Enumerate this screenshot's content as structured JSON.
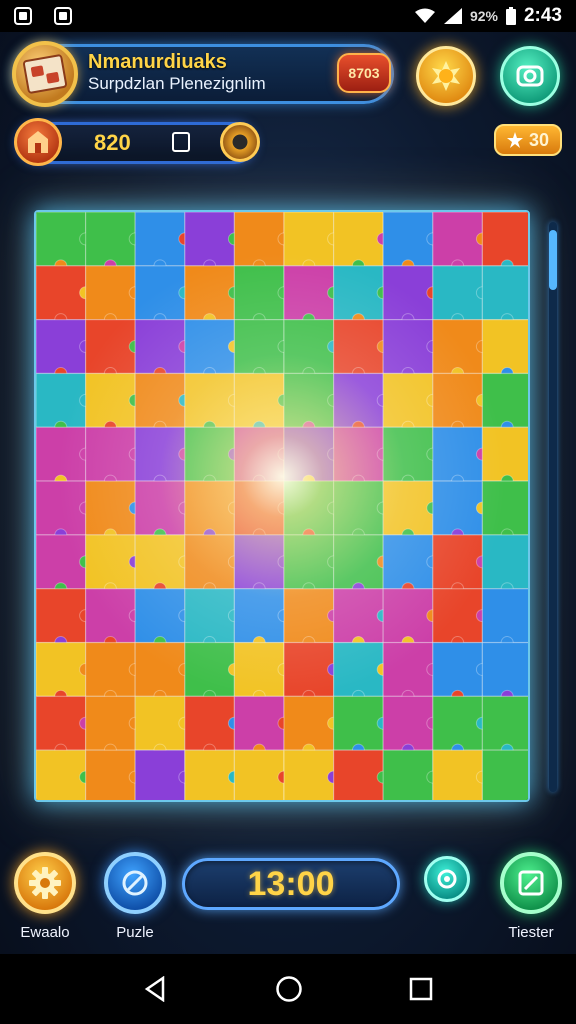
{
  "status_bar": {
    "battery": "92%",
    "time": "2:43"
  },
  "header": {
    "player_name": "Nmanurdiuaks",
    "player_subtitle": "Surpdzlan Plenezignlim",
    "coin_value": "8703"
  },
  "score_bar": {
    "score": "820",
    "stars": "30"
  },
  "toolbar": {
    "gear_label": "Ewaalo",
    "puzzle_label": "Puzle",
    "timer": "13:00",
    "edit_label": "Tiester"
  },
  "colors": {
    "accent_gold": "#ffd447",
    "frame_blue": "#3d8fe0",
    "glow_cyan": "#78dcff",
    "piece_palette": [
      "#f2c324",
      "#f08a1a",
      "#e8452a",
      "#3fbf4a",
      "#2f8fe8",
      "#8a3fd8",
      "#29b8c4",
      "#cc3fa8"
    ]
  },
  "icons": [
    "puzzle-avatar-icon",
    "sun-icon",
    "camera-icon",
    "home-icon",
    "card-icon",
    "medal-icon",
    "star-icon",
    "gear-icon",
    "puzzle-icon",
    "target-icon",
    "pencil-icon",
    "back-icon",
    "home-circle-icon",
    "recents-icon"
  ]
}
